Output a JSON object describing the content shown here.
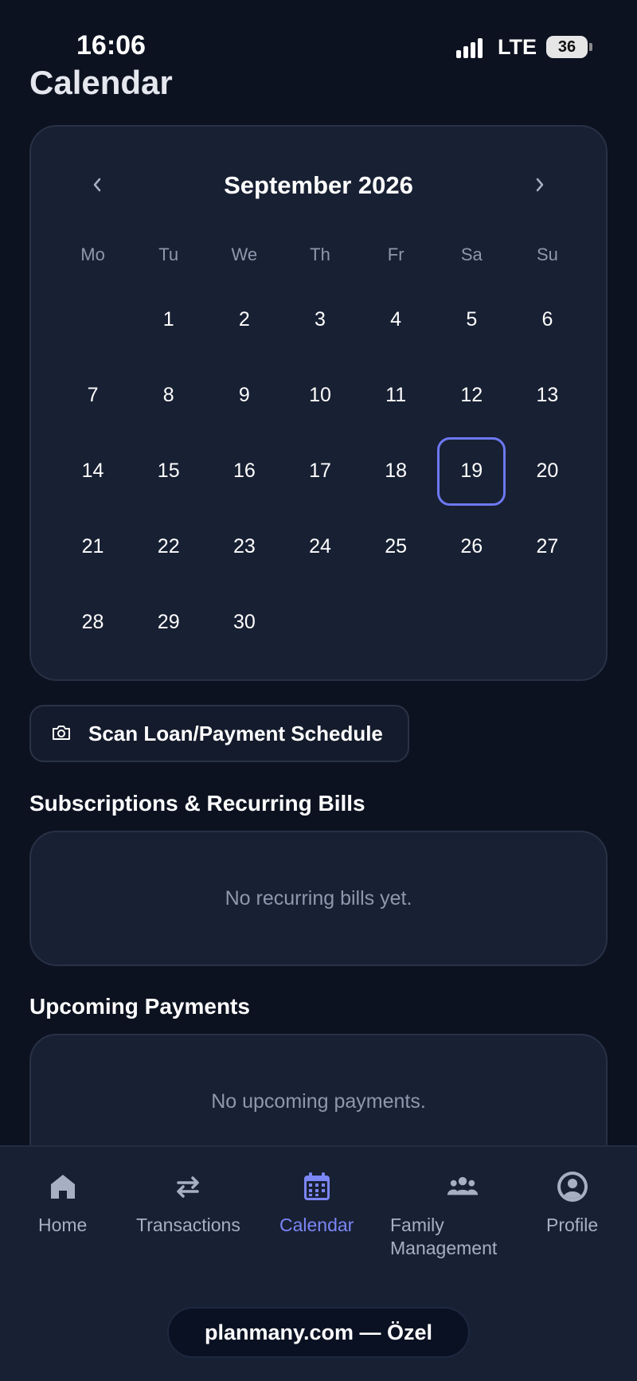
{
  "status": {
    "time": "16:06",
    "network": "LTE",
    "battery": "36"
  },
  "page": {
    "title": "Calendar"
  },
  "calendar": {
    "month_label": "September 2026",
    "weekdays": [
      "Mo",
      "Tu",
      "We",
      "Th",
      "Fr",
      "Sa",
      "Su"
    ],
    "leading_blanks": 1,
    "days": [
      "1",
      "2",
      "3",
      "4",
      "5",
      "6",
      "7",
      "8",
      "9",
      "10",
      "11",
      "12",
      "13",
      "14",
      "15",
      "16",
      "17",
      "18",
      "19",
      "20",
      "21",
      "22",
      "23",
      "24",
      "25",
      "26",
      "27",
      "28",
      "29",
      "30"
    ],
    "selected_day": "19",
    "accent_color": "#6d79f4"
  },
  "scan": {
    "label": "Scan Loan/Payment Schedule",
    "icon": "camera-icon"
  },
  "recurring": {
    "title": "Subscriptions & Recurring Bills",
    "empty_text": "No recurring bills yet."
  },
  "upcoming": {
    "title": "Upcoming Payments",
    "empty_text": "No upcoming payments."
  },
  "nav": {
    "active": "calendar",
    "active_color": "#7b86f7",
    "items": [
      {
        "label": "Home",
        "icon": "home-icon"
      },
      {
        "label": "Transactions",
        "icon": "swap-arrows-icon"
      },
      {
        "label": "Calendar",
        "icon": "calendar-icon"
      },
      {
        "label": "Family\nManagement",
        "icon": "family-icon"
      },
      {
        "label": "Profile",
        "icon": "profile-icon"
      }
    ]
  },
  "browser": {
    "url": "planmany.com — Özel"
  }
}
